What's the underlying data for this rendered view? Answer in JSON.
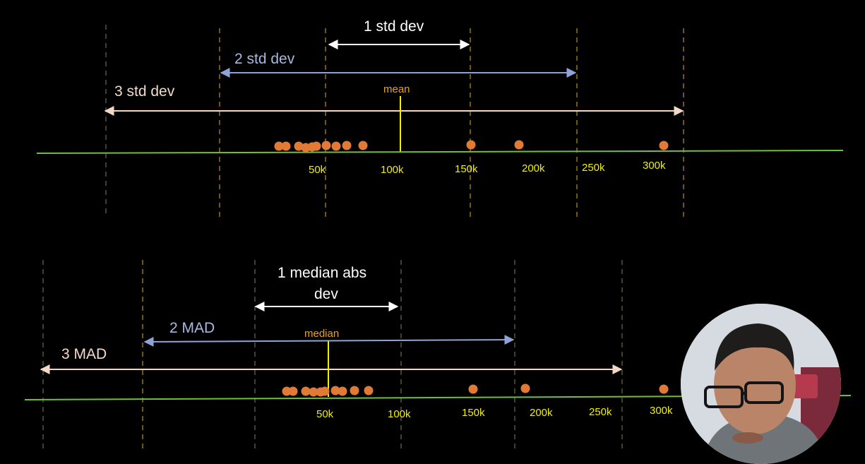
{
  "top_panel": {
    "labels": {
      "one": "1 std dev",
      "two": "2 std dev",
      "three": "3 std dev",
      "center": "mean"
    },
    "ticks": [
      "50k",
      "100k",
      "150k",
      "200k",
      "250k",
      "300k"
    ]
  },
  "bottom_panel": {
    "labels": {
      "one_line1": "1 median abs",
      "one_line2": "dev",
      "two": "2 MAD",
      "three": "3 MAD",
      "center": "median"
    },
    "ticks": [
      "50k",
      "100k",
      "150k",
      "200k",
      "250k",
      "300k"
    ]
  },
  "colors": {
    "axis_line": "#6fbf3a",
    "marker_line": "#f1f000",
    "dashed_boundary": "#b7931f",
    "white_arrow": "#ffffff",
    "blue_arrow": "#8fa3d6",
    "peach_arrow": "#f3d8c4",
    "point": "#e07a35"
  }
}
